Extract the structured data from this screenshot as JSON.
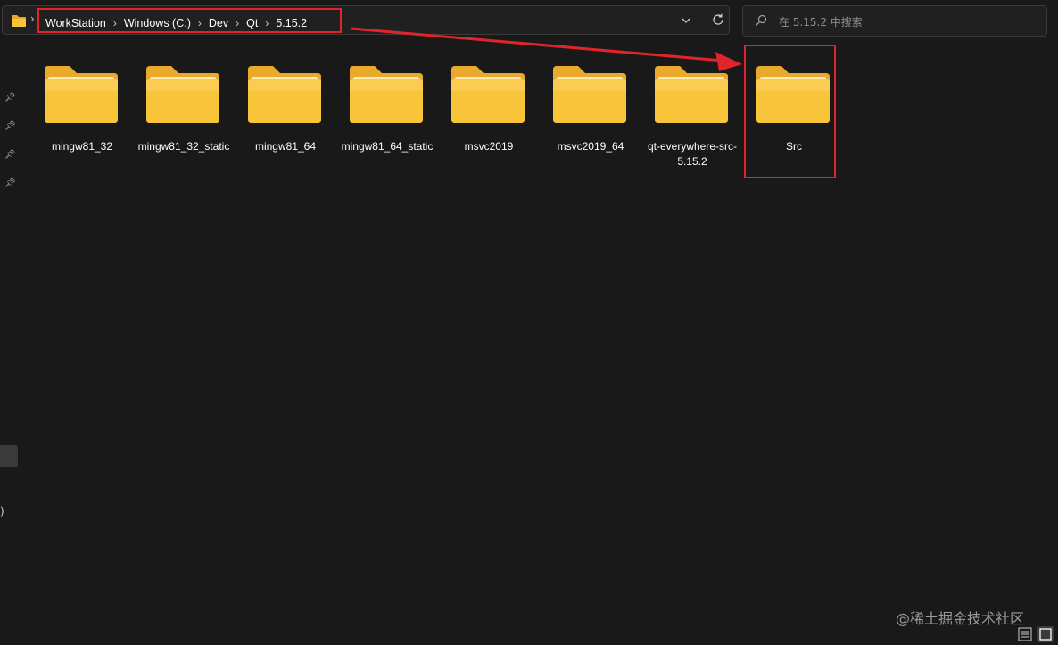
{
  "address_bar": {
    "breadcrumbs": [
      {
        "label": "WorkStation"
      },
      {
        "label": "Windows (C:)"
      },
      {
        "label": "Dev"
      },
      {
        "label": "Qt"
      },
      {
        "label": "5.15.2"
      }
    ]
  },
  "search": {
    "placeholder": "在 5.15.2 中搜索"
  },
  "folders": [
    {
      "name": "mingw81_32"
    },
    {
      "name": "mingw81_32_static"
    },
    {
      "name": "mingw81_64"
    },
    {
      "name": "mingw81_64_static"
    },
    {
      "name": "msvc2019"
    },
    {
      "name": "msvc2019_64"
    },
    {
      "name": "qt-everywhere-src-5.15.2"
    },
    {
      "name": "Src"
    }
  ],
  "nav_pane": {
    "stub_text": ")"
  },
  "watermark": "@稀土掘金技术社区",
  "colors": {
    "background": "#191919",
    "annotation_red": "#e0242b",
    "folder_yellow": "#f8c43a"
  }
}
